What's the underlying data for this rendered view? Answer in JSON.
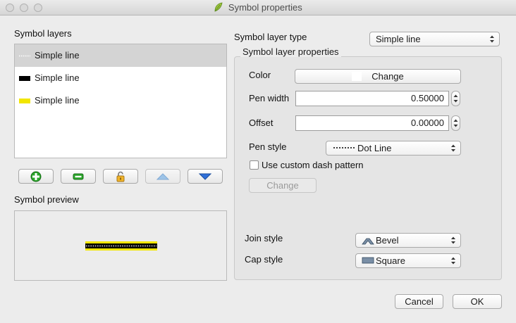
{
  "window": {
    "title": "Symbol properties"
  },
  "layers_panel": {
    "heading": "Symbol layers",
    "items": [
      {
        "label": "Simple line",
        "selected": true,
        "swatch": "dotted-white"
      },
      {
        "label": "Simple line",
        "selected": false,
        "swatch": "#000000"
      },
      {
        "label": "Simple line",
        "selected": false,
        "swatch": "#f2e600"
      }
    ],
    "toolbar": [
      "add-layer-icon",
      "remove-layer-icon",
      "lock-icon",
      "move-up-icon",
      "move-down-icon"
    ]
  },
  "preview": {
    "heading": "Symbol preview"
  },
  "layer_type": {
    "label": "Symbol layer type",
    "value": "Simple line"
  },
  "properties": {
    "heading": "Symbol layer properties",
    "color_label": "Color",
    "color_button": "Change",
    "pen_width_label": "Pen width",
    "pen_width_value": "0.50000",
    "offset_label": "Offset",
    "offset_value": "0.00000",
    "pen_style_label": "Pen style",
    "pen_style_value": "Dot Line",
    "custom_dash_label": "Use custom dash pattern",
    "custom_dash_checked": false,
    "dash_change_button": "Change",
    "join_style_label": "Join style",
    "join_style_value": "Bevel",
    "cap_style_label": "Cap style",
    "cap_style_value": "Square"
  },
  "footer": {
    "cancel": "Cancel",
    "ok": "OK"
  },
  "colors": {
    "accent_blue": "#2f6fd8",
    "add_green": "#2aa52a",
    "yellow": "#f2e600"
  }
}
